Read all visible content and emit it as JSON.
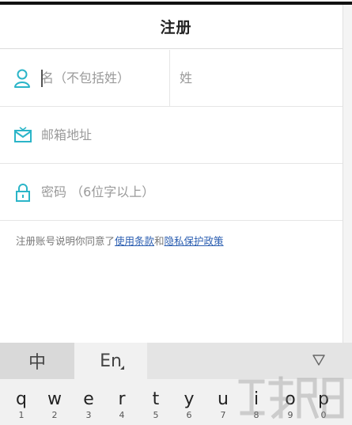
{
  "header": {
    "title": "注册"
  },
  "form": {
    "first_name_placeholder": "名（不包括姓）",
    "last_name_placeholder": "姓",
    "email_placeholder": "邮箱地址",
    "password_placeholder": "密码 （6位字以上）"
  },
  "terms": {
    "prefix": "注册账号说明你同意了",
    "terms_link": "使用条款",
    "conjunction": "和",
    "privacy_link": "隐私保护政策"
  },
  "keyboard": {
    "tab_chinese": "中",
    "tab_english": "En",
    "keys": [
      {
        "ch": "q",
        "num": "1"
      },
      {
        "ch": "w",
        "num": "2"
      },
      {
        "ch": "e",
        "num": "3"
      },
      {
        "ch": "r",
        "num": "4"
      },
      {
        "ch": "t",
        "num": "5"
      },
      {
        "ch": "y",
        "num": "6"
      },
      {
        "ch": "u",
        "num": "7"
      },
      {
        "ch": "i",
        "num": "8"
      },
      {
        "ch": "o",
        "num": "9"
      },
      {
        "ch": "p",
        "num": "0"
      }
    ]
  },
  "colors": {
    "accent": "#2bb5c8",
    "link": "#2a5db0"
  }
}
